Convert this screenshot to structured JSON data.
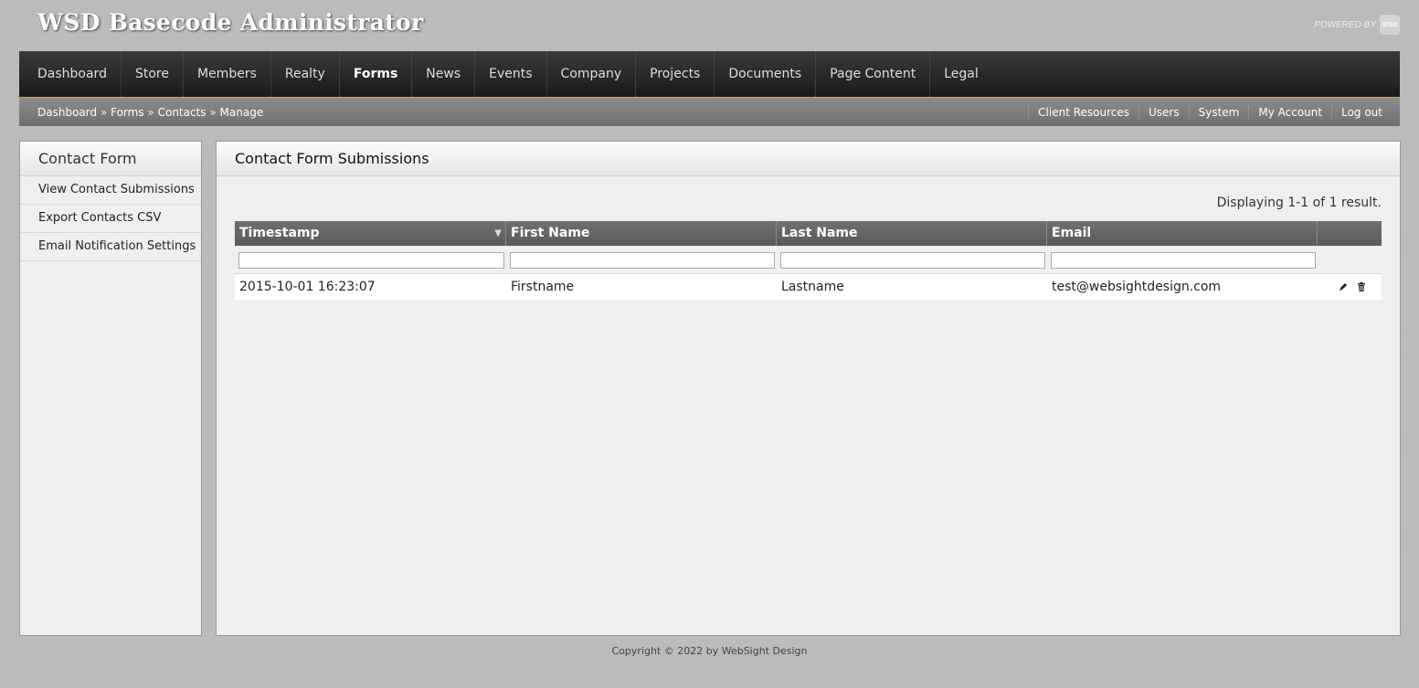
{
  "app": {
    "title": "WSD Basecode Administrator",
    "powered_by": "POWERED BY",
    "logo_text": "WSD"
  },
  "main_nav": {
    "items": [
      {
        "label": "Dashboard"
      },
      {
        "label": "Store"
      },
      {
        "label": "Members"
      },
      {
        "label": "Realty"
      },
      {
        "label": "Forms",
        "active": true
      },
      {
        "label": "News"
      },
      {
        "label": "Events"
      },
      {
        "label": "Company"
      },
      {
        "label": "Projects"
      },
      {
        "label": "Documents"
      },
      {
        "label": "Page Content"
      },
      {
        "label": "Legal"
      }
    ]
  },
  "breadcrumb": {
    "items": [
      "Dashboard",
      "Forms",
      "Contacts",
      "Manage"
    ],
    "separator": "»"
  },
  "util_nav": {
    "items": [
      "Client Resources",
      "Users",
      "System",
      "My Account",
      "Log out"
    ]
  },
  "sidebar": {
    "title": "Contact Form",
    "links": [
      "View Contact Submissions",
      "Export Contacts CSV",
      "Email Notification Settings"
    ]
  },
  "content": {
    "title": "Contact Form Submissions",
    "result_count": "Displaying 1-1 of 1 result.",
    "columns": [
      "Timestamp",
      "First Name",
      "Last Name",
      "Email"
    ],
    "sort_indicator": "▼",
    "rows": [
      {
        "timestamp": "2015-10-01 16:23:07",
        "first_name": "Firstname",
        "last_name": "Lastname",
        "email": "test@websightdesign.com"
      }
    ]
  },
  "footer": {
    "copyright": "Copyright © 2022 by WebSight Design"
  },
  "colors": {
    "nav_bg": "#1a1a1a",
    "nav_accent": "#c9a25a",
    "subnav_bg": "#7a7a7a",
    "grid_header": "#5a5a5a"
  }
}
